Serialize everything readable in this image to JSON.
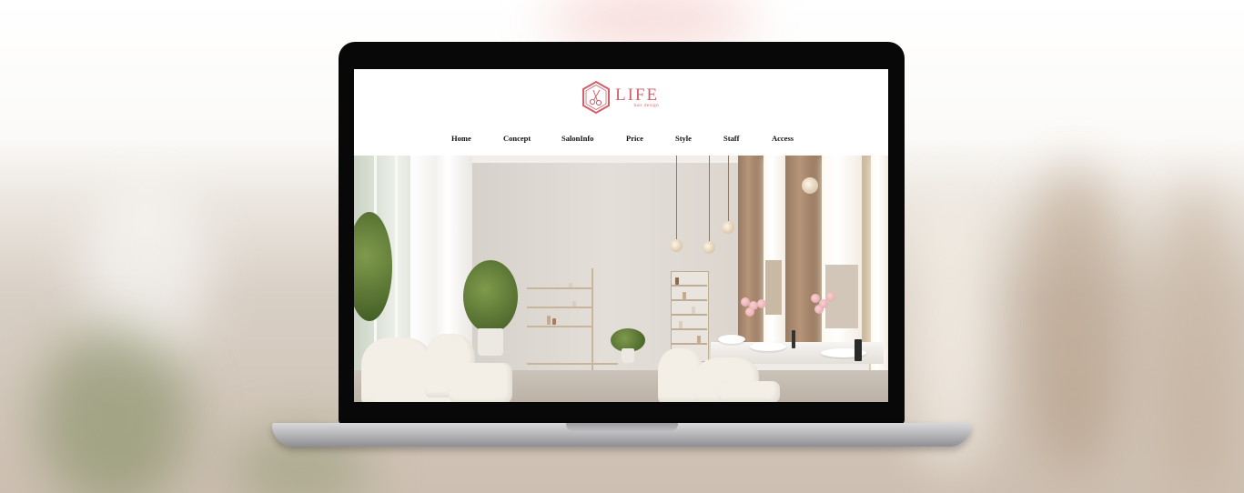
{
  "site": {
    "brand_name": "LIFE",
    "brand_tagline": "hair design",
    "logo_icon": "scissors-hexagon-icon",
    "brand_color": "#d0606a"
  },
  "nav": {
    "items": [
      {
        "label": "Home"
      },
      {
        "label": "Concept"
      },
      {
        "label": "SalonInfo"
      },
      {
        "label": "Price"
      },
      {
        "label": "Style"
      },
      {
        "label": "Staff"
      },
      {
        "label": "Access"
      }
    ]
  },
  "hero": {
    "subject": "salon-interior-photo"
  }
}
